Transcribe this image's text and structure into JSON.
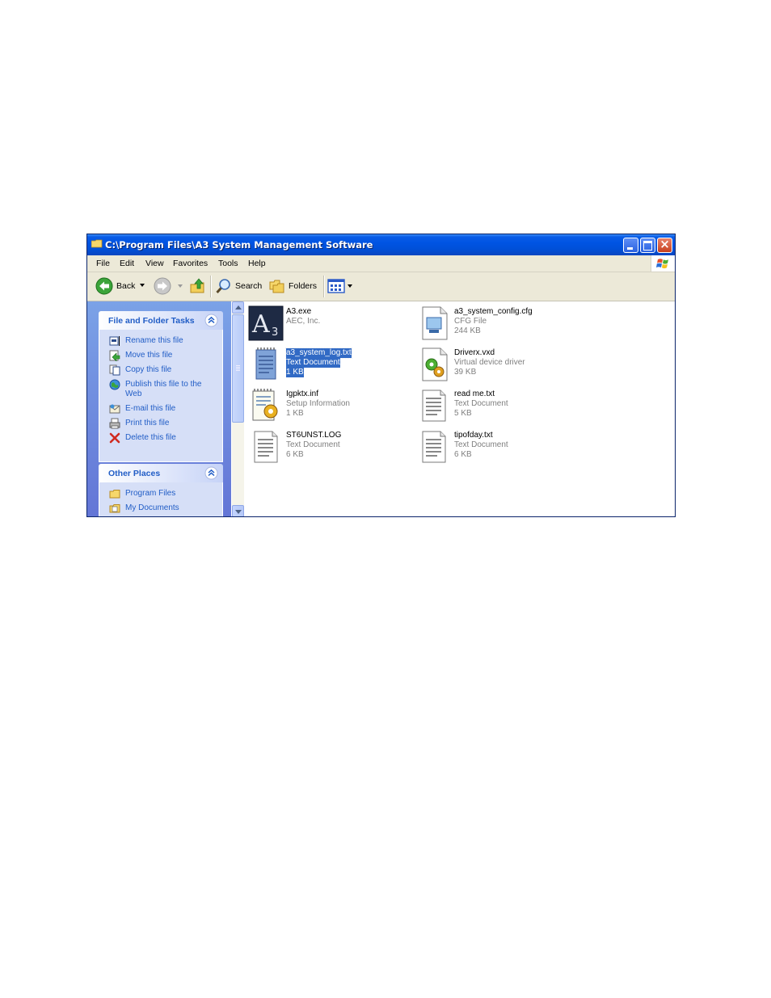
{
  "window": {
    "title": "C:\\Program Files\\A3 System Management Software"
  },
  "menu": {
    "items": [
      "File",
      "Edit",
      "View",
      "Favorites",
      "Tools",
      "Help"
    ]
  },
  "toolbar": {
    "back_label": "Back",
    "search_label": "Search",
    "folders_label": "Folders"
  },
  "tasks_panel": {
    "title": "File and Folder Tasks",
    "items": [
      {
        "label": "Rename this file",
        "icon": "rename-icon"
      },
      {
        "label": "Move this file",
        "icon": "move-icon"
      },
      {
        "label": "Copy this file",
        "icon": "copy-icon"
      },
      {
        "label": "Publish this file to the",
        "label2": "Web",
        "icon": "publish-icon"
      },
      {
        "label": "E-mail this file",
        "icon": "email-icon"
      },
      {
        "label": "Print this file",
        "icon": "print-icon"
      },
      {
        "label": "Delete this file",
        "icon": "delete-icon"
      }
    ]
  },
  "places_panel": {
    "title": "Other Places",
    "items": [
      {
        "label": "Program Files",
        "icon": "folder-icon"
      },
      {
        "label": "My Documents",
        "icon": "my-documents-icon"
      }
    ]
  },
  "files": [
    {
      "name": "A3.exe",
      "type": "AEC, Inc.",
      "size": "",
      "icon": "a3-app-icon"
    },
    {
      "name": "a3_system_config.cfg",
      "type": "CFG File",
      "size": "244 KB",
      "icon": "cfg-file-icon"
    },
    {
      "name": "a3_system_log.txt",
      "type": "Text Document",
      "size": "1 KB",
      "icon": "notepad-icon",
      "selected": true
    },
    {
      "name": "Driverx.vxd",
      "type": "Virtual device driver",
      "size": "39 KB",
      "icon": "driver-icon"
    },
    {
      "name": "Igpktx.inf",
      "type": "Setup Information",
      "size": "1 KB",
      "icon": "setup-info-icon"
    },
    {
      "name": "read me.txt",
      "type": "Text Document",
      "size": "5 KB",
      "icon": "text-document-icon"
    },
    {
      "name": "ST6UNST.LOG",
      "type": "Text Document",
      "size": "6 KB",
      "icon": "text-document-icon"
    },
    {
      "name": "tipofday.txt",
      "type": "Text Document",
      "size": "6 KB",
      "icon": "text-document-icon"
    }
  ],
  "colors": {
    "titlebar": "#0054e3",
    "task_link": "#215dc6",
    "selection": "#316ac5",
    "chrome": "#ece9d8"
  }
}
